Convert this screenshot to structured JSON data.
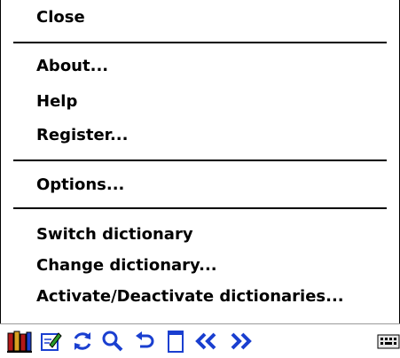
{
  "menu": {
    "items": [
      {
        "label": "Close"
      },
      {
        "label": "About..."
      },
      {
        "label": "Help"
      },
      {
        "label": "Register..."
      },
      {
        "label": "Options..."
      },
      {
        "label": "Switch dictionary"
      },
      {
        "label": "Change dictionary..."
      },
      {
        "label": "Activate/Deactivate dictionaries..."
      }
    ]
  },
  "taskbar": {
    "icons": [
      "books-icon",
      "edit-note-icon",
      "sync-icon",
      "search-icon",
      "undo-icon",
      "notepad-icon",
      "double-chevron-left-icon",
      "double-chevron-right-icon",
      "keyboard-icon"
    ]
  },
  "colors": {
    "menu_bg": "#ffffff",
    "text": "#000000",
    "separator": "#000000",
    "accent_blue": "#1a3fd0",
    "icon_red": "#b21818",
    "icon_green": "#2a9a2a"
  }
}
